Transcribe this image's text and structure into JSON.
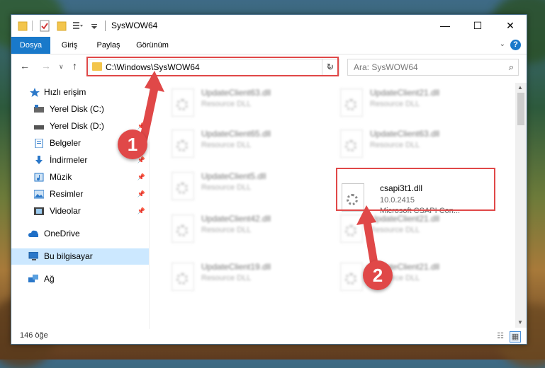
{
  "window": {
    "title": "SysWOW64",
    "minimize": "—",
    "maximize": "☐",
    "close": "✕"
  },
  "ribbon": {
    "tabs": [
      "Dosya",
      "Giriş",
      "Paylaş",
      "Görünüm"
    ],
    "help": "?"
  },
  "address": {
    "path": "C:\\Windows\\SysWOW64",
    "search_placeholder": "Ara: SysWOW64"
  },
  "sidebar": {
    "items": [
      {
        "label": "Hızlı erişim",
        "icon": "star-icon"
      },
      {
        "label": "Yerel Disk (C:)",
        "icon": "drive-icon"
      },
      {
        "label": "Yerel Disk (D:)",
        "icon": "drive-icon"
      },
      {
        "label": "Belgeler",
        "icon": "documents-icon"
      },
      {
        "label": "İndirmeler",
        "icon": "download-icon"
      },
      {
        "label": "Müzik",
        "icon": "music-icon"
      },
      {
        "label": "Resimler",
        "icon": "pictures-icon"
      },
      {
        "label": "Videolar",
        "icon": "video-icon"
      },
      {
        "label": "OneDrive",
        "icon": "cloud-icon"
      },
      {
        "label": "Bu bilgisayar",
        "icon": "computer-icon"
      },
      {
        "label": "Ağ",
        "icon": "network-icon"
      }
    ]
  },
  "files": [
    {
      "name": "UpdateClient63.dll",
      "line1": "Resource DLL",
      "line2": ""
    },
    {
      "name": "UpdateClient21.dll",
      "line1": "Resource DLL",
      "line2": ""
    },
    {
      "name": "UpdateClient65.dll",
      "line1": "Resource DLL",
      "line2": ""
    },
    {
      "name": "UpdateClient63.dll",
      "line1": "Resource DLL",
      "line2": ""
    },
    {
      "name": "UpdateClient5.dll",
      "line1": "Resource DLL",
      "line2": ""
    },
    {
      "name": "csapi3t1.dll",
      "line1": "10.0.2415",
      "line2": "Microsoft CSAPI Con..."
    },
    {
      "name": "UpdateClient42.dll",
      "line1": "Resource DLL",
      "line2": ""
    },
    {
      "name": "UpdateClient21.dll",
      "line1": "Resource DLL",
      "line2": ""
    },
    {
      "name": "UpdateClient19.dll",
      "line1": "Resource DLL",
      "line2": ""
    },
    {
      "name": "UpdateClient21.dll",
      "line1": "Resource DLL",
      "line2": ""
    }
  ],
  "status": {
    "count": "146 öğe"
  },
  "markers": [
    "1",
    "2"
  ],
  "colors": {
    "accent": "#1979ca",
    "highlight": "#e04848",
    "selected": "#cce8ff"
  }
}
